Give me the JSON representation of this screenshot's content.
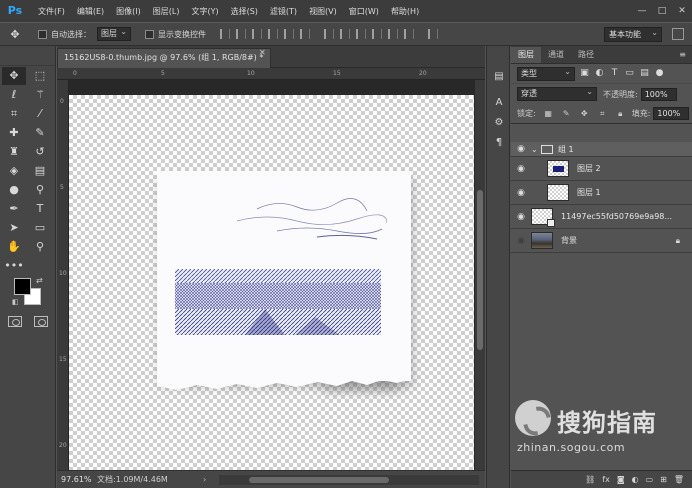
{
  "app": {
    "logo": "Ps"
  },
  "menu": [
    "文件(F)",
    "编辑(E)",
    "图像(I)",
    "图层(L)",
    "文字(Y)",
    "选择(S)",
    "滤镜(T)",
    "视图(V)",
    "窗口(W)",
    "帮助(H)"
  ],
  "options": {
    "auto_select_label": "自动选择：",
    "auto_select_value": "图层",
    "show_transform_label": "显示变换控件",
    "workspace": "基本功能"
  },
  "document": {
    "tab_title": "15162US8-0.thumb.jpg @ 97.6% (组 1, RGB/8#) *",
    "zoom": "97.61%",
    "info": "文档:1.09M/4.46M"
  },
  "ruler": {
    "top": [
      "0",
      "5",
      "10",
      "15",
      "20"
    ],
    "left": [
      "0",
      "5",
      "10",
      "15",
      "20"
    ]
  },
  "layers_panel": {
    "tabs": [
      "图层",
      "通道",
      "路径"
    ],
    "filter_kind": "类型",
    "blend_mode": "穿透",
    "opacity_label": "不透明度:",
    "opacity": "100%",
    "lock_label": "锁定:",
    "fill_label": "填充:",
    "fill": "100%",
    "layers": [
      {
        "name": "组 1",
        "type": "group",
        "visible": true
      },
      {
        "name": "图层 2",
        "type": "layer",
        "visible": true
      },
      {
        "name": "图层 1",
        "type": "layer",
        "visible": true
      },
      {
        "name": "11497ec55fd50769e9a98...",
        "type": "smart",
        "visible": true
      },
      {
        "name": "背景",
        "type": "background",
        "visible": false,
        "locked": true
      }
    ]
  },
  "watermark": {
    "title": "搜狗指南",
    "url": "zhinan.sogou.com"
  },
  "colors": {
    "accent": "#31a8ff",
    "sketch_ink": "#1b1f75"
  }
}
